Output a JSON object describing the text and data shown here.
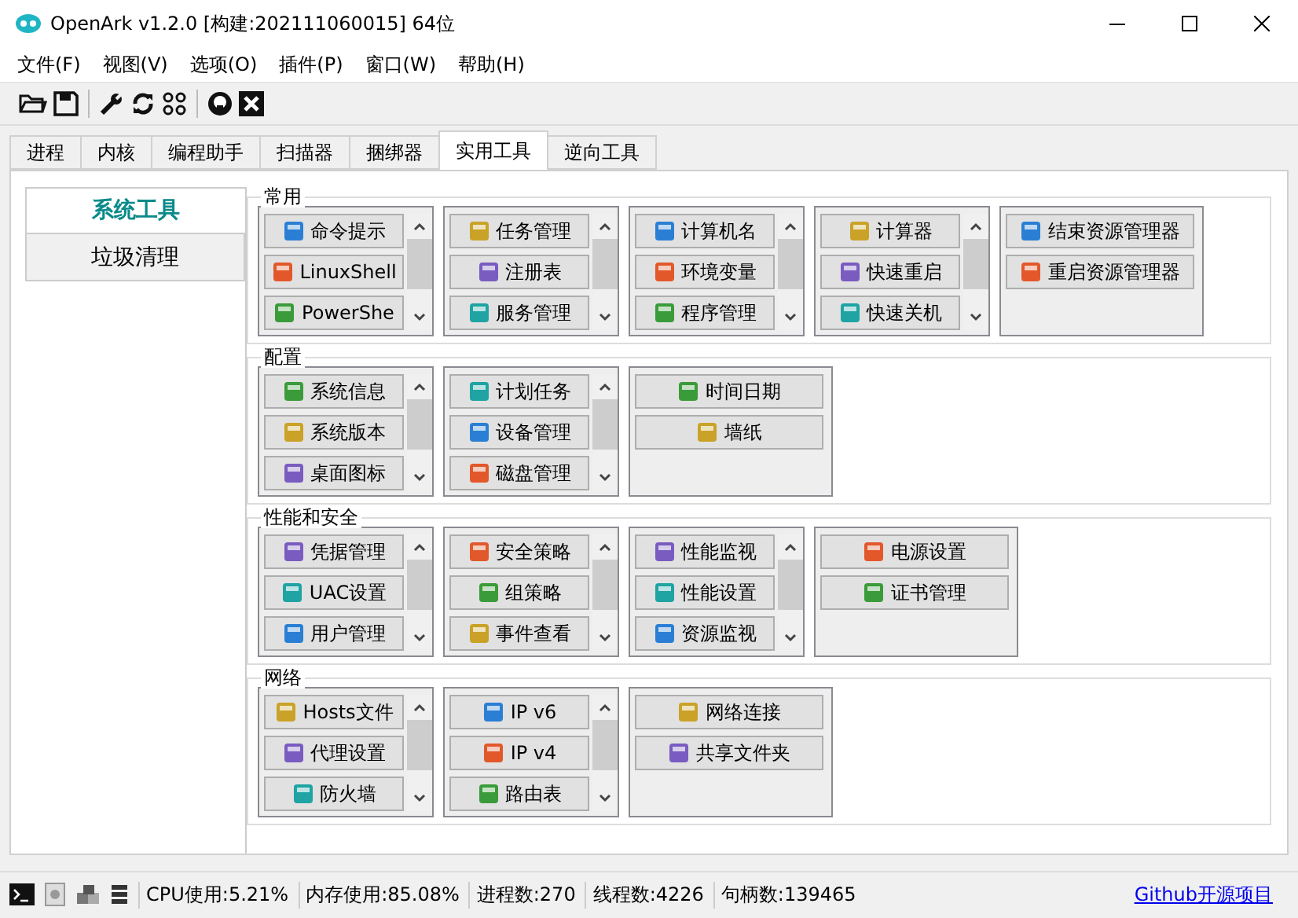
{
  "window": {
    "title": "OpenArk v1.2.0  [构建:202111060015]  64位"
  },
  "menu": [
    "文件(F)",
    "视图(V)",
    "选项(O)",
    "插件(P)",
    "窗口(W)",
    "帮助(H)"
  ],
  "tabs": [
    {
      "label": "进程",
      "selected": false
    },
    {
      "label": "内核",
      "selected": false
    },
    {
      "label": "编程助手",
      "selected": false
    },
    {
      "label": "扫描器",
      "selected": false
    },
    {
      "label": "捆绑器",
      "selected": false
    },
    {
      "label": "实用工具",
      "selected": true
    },
    {
      "label": "逆向工具",
      "selected": false
    }
  ],
  "sidebar": {
    "items": [
      {
        "label": "系统工具",
        "selected": true
      },
      {
        "label": "垃圾清理",
        "selected": false
      }
    ]
  },
  "sections": [
    {
      "title": "常用",
      "groups": [
        {
          "scrollable": true,
          "buttons": [
            "命令提示",
            "LinuxShell",
            "PowerShe"
          ]
        },
        {
          "scrollable": true,
          "buttons": [
            "任务管理",
            "注册表",
            "服务管理"
          ]
        },
        {
          "scrollable": true,
          "buttons": [
            "计算机名",
            "环境变量",
            "程序管理"
          ]
        },
        {
          "scrollable": true,
          "buttons": [
            "计算器",
            "快速重启",
            "快速关机"
          ]
        },
        {
          "scrollable": false,
          "buttons": [
            "结束资源管理器",
            "重启资源管理器"
          ]
        }
      ]
    },
    {
      "title": "配置",
      "groups": [
        {
          "scrollable": true,
          "buttons": [
            "系统信息",
            "系统版本",
            "桌面图标"
          ]
        },
        {
          "scrollable": true,
          "buttons": [
            "计划任务",
            "设备管理",
            "磁盘管理"
          ]
        },
        {
          "scrollable": false,
          "buttons": [
            "时间日期",
            "墙纸"
          ]
        }
      ]
    },
    {
      "title": "性能和安全",
      "groups": [
        {
          "scrollable": true,
          "buttons": [
            "凭据管理",
            "UAC设置",
            "用户管理"
          ]
        },
        {
          "scrollable": true,
          "buttons": [
            "安全策略",
            "组策略",
            "事件查看"
          ]
        },
        {
          "scrollable": true,
          "buttons": [
            "性能监视",
            "性能设置",
            "资源监视"
          ]
        },
        {
          "scrollable": false,
          "buttons": [
            "电源设置",
            "证书管理"
          ]
        }
      ]
    },
    {
      "title": "网络",
      "groups": [
        {
          "scrollable": true,
          "buttons": [
            "Hosts文件",
            "代理设置",
            "防火墙"
          ]
        },
        {
          "scrollable": true,
          "buttons": [
            "IP v6",
            "IP v4",
            "路由表"
          ]
        },
        {
          "scrollable": false,
          "buttons": [
            "网络连接",
            "共享文件夹"
          ]
        }
      ]
    }
  ],
  "status_bar": {
    "stats": [
      "CPU使用:5.21%",
      "内存使用:85.08%",
      "进程数:270",
      "线程数:4226",
      "句柄数:139465"
    ],
    "link": "Github开源项目"
  }
}
